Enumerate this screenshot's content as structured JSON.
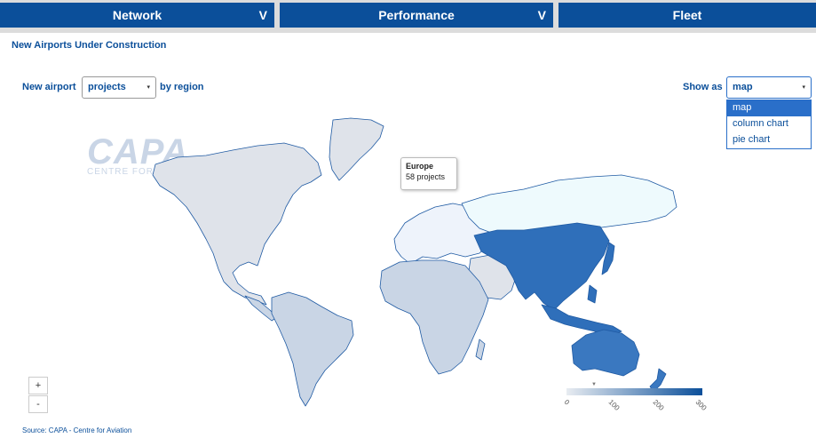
{
  "nav": {
    "tabs": [
      {
        "label": "Network",
        "chevron": "V"
      },
      {
        "label": "Performance",
        "chevron": "V"
      },
      {
        "label": "Fleet"
      }
    ]
  },
  "page": {
    "title": "New Airports Under Construction"
  },
  "controls": {
    "prefix_label": "New airport",
    "metric_value": "projects",
    "suffix_label": "by region",
    "show_as_label": "Show as",
    "show_as_value": "map",
    "show_as_options": [
      "map",
      "column chart",
      "pie chart"
    ]
  },
  "watermark": {
    "brand": "CAPA",
    "tagline": "CENTRE FOR AVIATION"
  },
  "tooltip": {
    "region": "Europe",
    "value_text": "58 projects"
  },
  "zoom": {
    "in_label": "+",
    "out_label": "-"
  },
  "legend": {
    "ticks": [
      "0",
      "100",
      "200",
      "300"
    ],
    "marker": "▼",
    "min_color": "#e8ecf1",
    "max_color": "#0b4f9a"
  },
  "source": "Source: CAPA - Centre for Aviation",
  "icons": {
    "dropdown_arrow": "▾"
  }
}
